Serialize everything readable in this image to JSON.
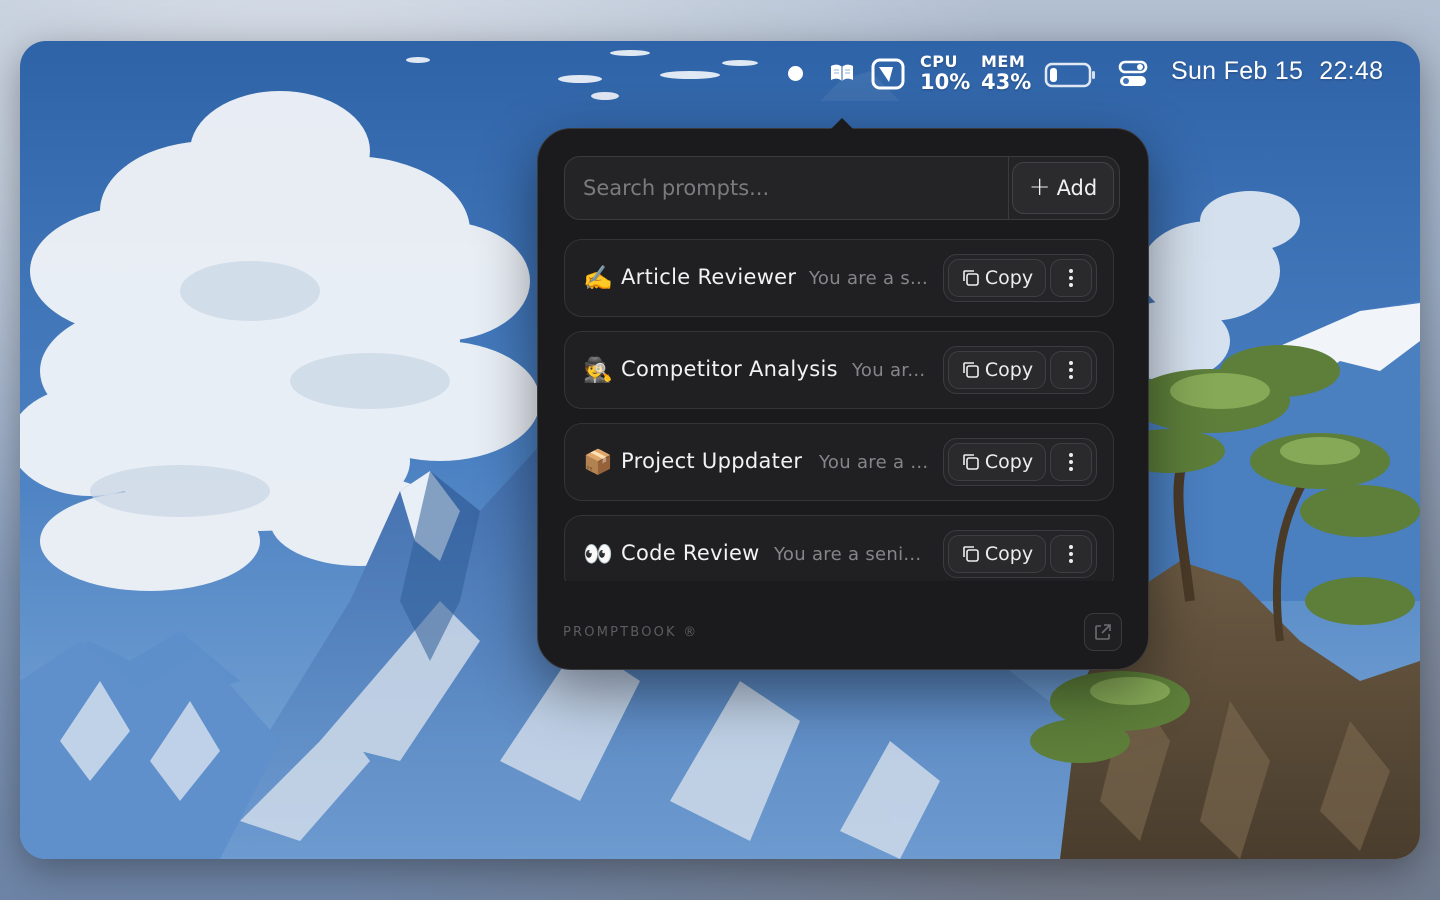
{
  "menubar": {
    "cpu_label": "CPU",
    "cpu_value": "10%",
    "mem_label": "MEM",
    "mem_value": "43%",
    "date": "Sun Feb 15",
    "time": "22:48",
    "battery_level": 0.2,
    "icons": [
      "status-dot-icon",
      "book-icon",
      "pin-icon",
      "battery-icon",
      "control-center-icon"
    ]
  },
  "popover": {
    "search_placeholder": "Search prompts...",
    "add_label": "Add",
    "prompts": [
      {
        "emoji": "✍️",
        "title": "Article Reviewer",
        "preview": "You are a s...",
        "copy_label": "Copy"
      },
      {
        "emoji": "🕵️",
        "title": "Competitor Analysis",
        "preview": "You ar...",
        "copy_label": "Copy"
      },
      {
        "emoji": "📦",
        "title": "Project Uppdater",
        "preview": "You are a ...",
        "copy_label": "Copy"
      },
      {
        "emoji": "👀",
        "title": "Code Review",
        "preview": "You are a seni...",
        "copy_label": "Copy"
      }
    ],
    "footer_brand": "PROMPTBOOK ®"
  },
  "colors": {
    "popover_bg": "#1b1b1d",
    "row_bg": "#202022",
    "text_primary": "#f2f2f2",
    "text_muted": "#86868a",
    "sky": "#3f74b8"
  }
}
